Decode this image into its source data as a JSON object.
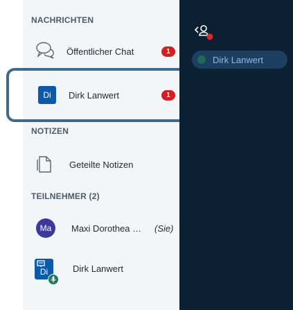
{
  "sidebar": {
    "messages_title": "NACHRICHTEN",
    "public_chat": {
      "label": "Öffentlicher Chat",
      "unread": "1"
    },
    "private_chat": {
      "avatar": "Di",
      "label": "Dirk Lanwert",
      "unread": "1"
    },
    "notes_title": "NOTIZEN",
    "shared_notes": {
      "label": "Geteilte Notizen"
    },
    "participants_title": "TEILNEHMER (2)",
    "participants": [
      {
        "avatar": "Ma",
        "name": "Maxi Dorothea …",
        "suffix": "(Sie)"
      },
      {
        "avatar": "Di",
        "name": "Dirk Lanwert"
      }
    ]
  },
  "chat_panel": {
    "user_chip": "Dirk Lanwert"
  },
  "colors": {
    "sidebar_bg": "#f3f6f9",
    "dark_panel_bg": "#0c2034",
    "badge_red": "#d21f1f",
    "avatar_blue": "#0f5aa8",
    "avatar_purple": "#3b3a9c",
    "focus_frame": "#3f6a8f"
  },
  "icons": [
    "chat-bubbles-icon",
    "notes-icon",
    "presenter-icon",
    "microphone-icon",
    "user-toggle-icon"
  ]
}
